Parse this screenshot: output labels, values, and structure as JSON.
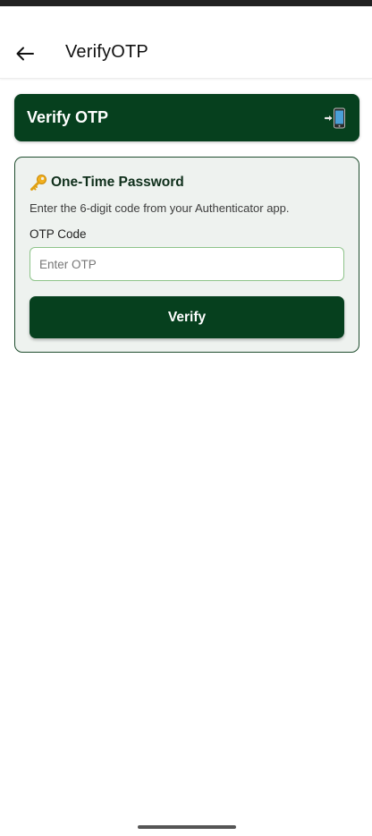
{
  "app_bar": {
    "title": "VerifyOTP",
    "back_icon": "arrow-left-icon"
  },
  "header_card": {
    "title": "Verify OTP",
    "icon": "mobile-phone-arrow-icon",
    "background_color": "#06401e"
  },
  "otp_card": {
    "heading_icon": "key-icon",
    "heading": "One-Time Password",
    "description": "Enter the 6-digit code from your Authenticator app.",
    "field_label": "OTP Code",
    "input_value": "",
    "input_placeholder": "Enter OTP",
    "submit_label": "Verify"
  },
  "colors": {
    "primary": "#06401e",
    "card_background": "#eef2ef",
    "input_border": "#8ec48a"
  }
}
